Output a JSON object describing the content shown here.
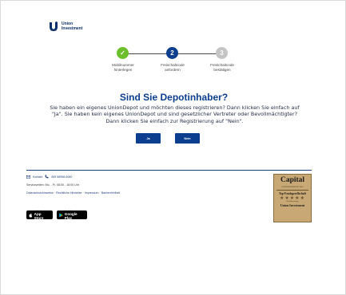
{
  "brand": {
    "logo_line1": "Union",
    "logo_line2": "Investment",
    "color": "#0b2f6b"
  },
  "stepper": {
    "steps": [
      {
        "number": "✓",
        "label_line1": "Mobilnummer",
        "label_line2": "hinterlegen",
        "state": "done",
        "color": "#6bbf2a"
      },
      {
        "number": "2",
        "label_line1": "Freischaltcode",
        "label_line2": "anfordern",
        "state": "active",
        "color": "#0b3e8f"
      },
      {
        "number": "3",
        "label_line1": "Freischaltcode",
        "label_line2": "bestätigen",
        "state": "pending",
        "color": "#c4c4c4"
      }
    ]
  },
  "main": {
    "title": "Sind Sie Depotinhaber?",
    "body_line1": "Sie haben ein eigenes UnionDepot und möchten dieses registrieren? Dann klicken Sie einfach auf",
    "body_line2": "\"Ja\". Sie haben kein eigenes UnionDepot und sind gesetzlicher Vertreter oder Bevollmächtigter?",
    "body_line3": "Dann klicken Sie einfach zur Registrierung auf \"Nein\".",
    "yes_label": "Ja",
    "no_label": "Nein",
    "accent_color": "#0b3e8f"
  },
  "footer": {
    "contact_label": "Kontakt",
    "phone": "069 58998-6060",
    "hours": "Servicezeiten: Mo. - Fr. 08:00 - 18:00 Uhr",
    "links": [
      "Datenschutzhinweise",
      "Rechtliche Hinweise",
      "Impressum",
      "Barrierefreiheit"
    ],
    "app_store": {
      "small": "Laden im",
      "big": "App Store",
      "icon": "apple-icon"
    },
    "google_play": {
      "small": "JETZT BEI",
      "big": "Google Play",
      "icon": "play-icon"
    }
  },
  "award": {
    "title": "Capital",
    "subtitle": "FONDSBEWERTUNG 2023",
    "claim": "Top-Fondsgesellschaft",
    "stars": "★★★★★",
    "small": "Höchstbewertung",
    "brand": "Union Investment"
  }
}
